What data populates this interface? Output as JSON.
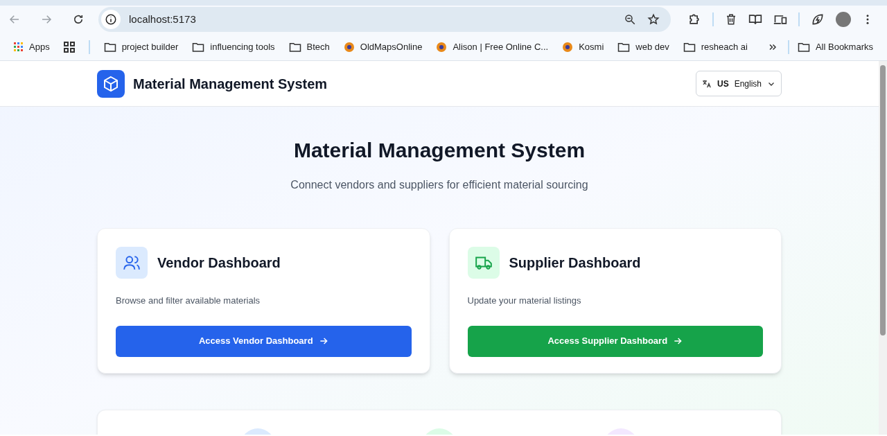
{
  "browser": {
    "url": "localhost:5173",
    "bookmarks": [
      {
        "label": "Apps",
        "kind": "apps"
      },
      {
        "label": "project builder",
        "kind": "folder"
      },
      {
        "label": "influencing tools",
        "kind": "folder"
      },
      {
        "label": "Btech",
        "kind": "folder"
      },
      {
        "label": "OldMapsOnline",
        "kind": "site"
      },
      {
        "label": "Alison | Free Online C...",
        "kind": "site"
      },
      {
        "label": "Kosmi",
        "kind": "site"
      },
      {
        "label": "web dev",
        "kind": "folder"
      },
      {
        "label": "resheach ai",
        "kind": "folder"
      }
    ],
    "all_bookmarks": "All Bookmarks"
  },
  "header": {
    "title": "Material Management System",
    "language": {
      "flag": "US",
      "label": "English"
    }
  },
  "hero": {
    "title": "Material Management System",
    "subtitle": "Connect vendors and suppliers for efficient material sourcing"
  },
  "cards": [
    {
      "kind": "vendor",
      "title": "Vendor Dashboard",
      "description": "Browse and filter available materials",
      "button": "Access Vendor Dashboard"
    },
    {
      "kind": "supplier",
      "title": "Supplier Dashboard",
      "description": "Update your material listings",
      "button": "Access Supplier Dashboard"
    }
  ],
  "features": [
    {
      "color": "#dbeafe"
    },
    {
      "color": "#dcfce7"
    },
    {
      "color": "#f3e8ff"
    }
  ]
}
